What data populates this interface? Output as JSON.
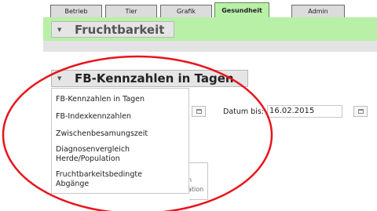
{
  "tabs": [
    "Betrieb",
    "Tier",
    "Grafik",
    "Gesundheit",
    "Admin"
  ],
  "active_tab": "Gesundheit",
  "section_title": "Fruchtbarkeit",
  "dropdown": {
    "selected": "FB-Kennzahlen in Tagen",
    "options": [
      "FB-Kennzahlen in Tagen",
      "FB-Indexkennzahlen",
      "Zwischenbesamungszeit",
      "Diagnosenvergleich Herde/Population",
      "Fruchtbarkeitsbedingte Abgänge"
    ]
  },
  "filter": {
    "date_to_label": "Datum bis:",
    "date_to_value": "16.02.2015"
  },
  "panel_partial_text": [
    "n",
    "ation"
  ],
  "annotation": {
    "color": "#e8141c"
  }
}
